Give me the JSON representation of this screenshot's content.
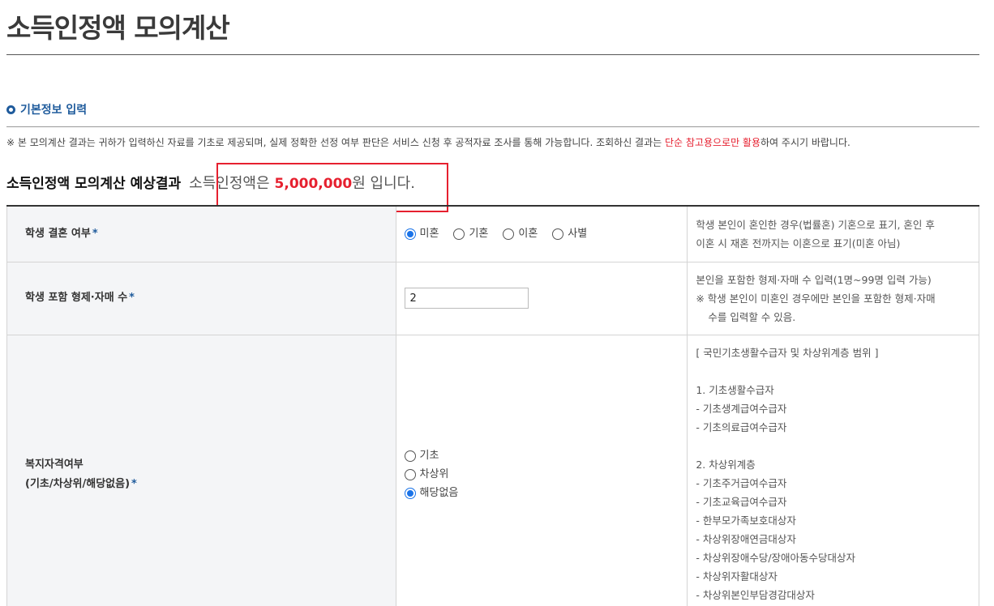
{
  "page": {
    "title": "소득인정액 모의계산"
  },
  "section": {
    "heading": "기본정보 입력"
  },
  "notice": {
    "prefix": "※ 본 모의계산 결과는 귀하가 입력하신 자료를 기초로 제공되며, 실제 정확한 선정 여부 판단은 서비스 신청 후 공적자료 조사를 통해 가능합니다. 조회하신 결과는 ",
    "emphasis": "단순 참고용으로만 활용",
    "suffix": "하여 주시기 바랍니다."
  },
  "result": {
    "label": "소득인정액 모의계산 예상결과",
    "prefix": "소득인정액은",
    "amount": "5,000,000",
    "suffix": "원 입니다."
  },
  "rows": {
    "marriage": {
      "label": "학생 결혼 여부",
      "required": "*",
      "options": [
        "미혼",
        "기혼",
        "이혼",
        "사별"
      ],
      "selected": "미혼",
      "desc": [
        "학생 본인이 혼인한 경우(법률혼) 기혼으로 표기, 혼인 후",
        "이혼 시 재혼 전까지는 이혼으로 표기(미혼 아님)"
      ]
    },
    "siblings": {
      "label": "학생 포함 형제·자매 수",
      "required": "*",
      "value": "2",
      "desc": [
        "본인을 포함한 형제·자매 수 입력(1명~99명 입력 가능)",
        "※ 학생 본인이 미혼인 경우에만 본인을 포함한 형제·자매",
        "수를 입력할 수 있음."
      ]
    },
    "welfare": {
      "label_line1": "복지자격여부",
      "label_line2": "(기초/차상위/해당없음)",
      "required": "*",
      "options": [
        "기초",
        "차상위",
        "해당없음"
      ],
      "selected": "해당없음",
      "desc_title": "[ 국민기초생활수급자 및 차상위계층 범위 ]",
      "group1_title": "1. 기초생활수급자",
      "group1_items": [
        "- 기초생계급여수급자",
        "- 기초의료급여수급자"
      ],
      "group2_title": "2. 차상위계층",
      "group2_items": [
        "- 기초주거급여수급자",
        "- 기초교육급여수급자",
        "- 한부모가족보호대상자",
        "- 차상위장애연금대상자",
        "- 차상위장애수당/장애아동수당대상자",
        "- 차상위자활대상자",
        "- 차상위본인부담경감대상자"
      ]
    }
  }
}
